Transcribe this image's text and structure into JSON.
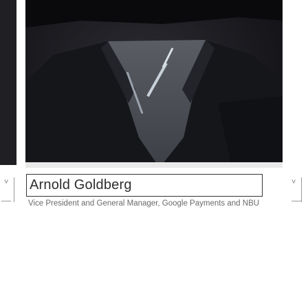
{
  "profile": {
    "name": "Arnold Goldberg",
    "title": "Vice President and General Manager, Google Payments and NBU"
  },
  "photo": {
    "description_icon": "portrait-photo",
    "background_color": "#111116"
  },
  "carousel": {
    "prev_icon": "chevron-down-icon",
    "next_icon": "chevron-down-icon",
    "prev_glyph": "˅",
    "next_glyph": "˅"
  },
  "colors": {
    "text_primary": "#2d2d2d",
    "text_secondary": "#6a6a6a",
    "border": "#333333"
  }
}
